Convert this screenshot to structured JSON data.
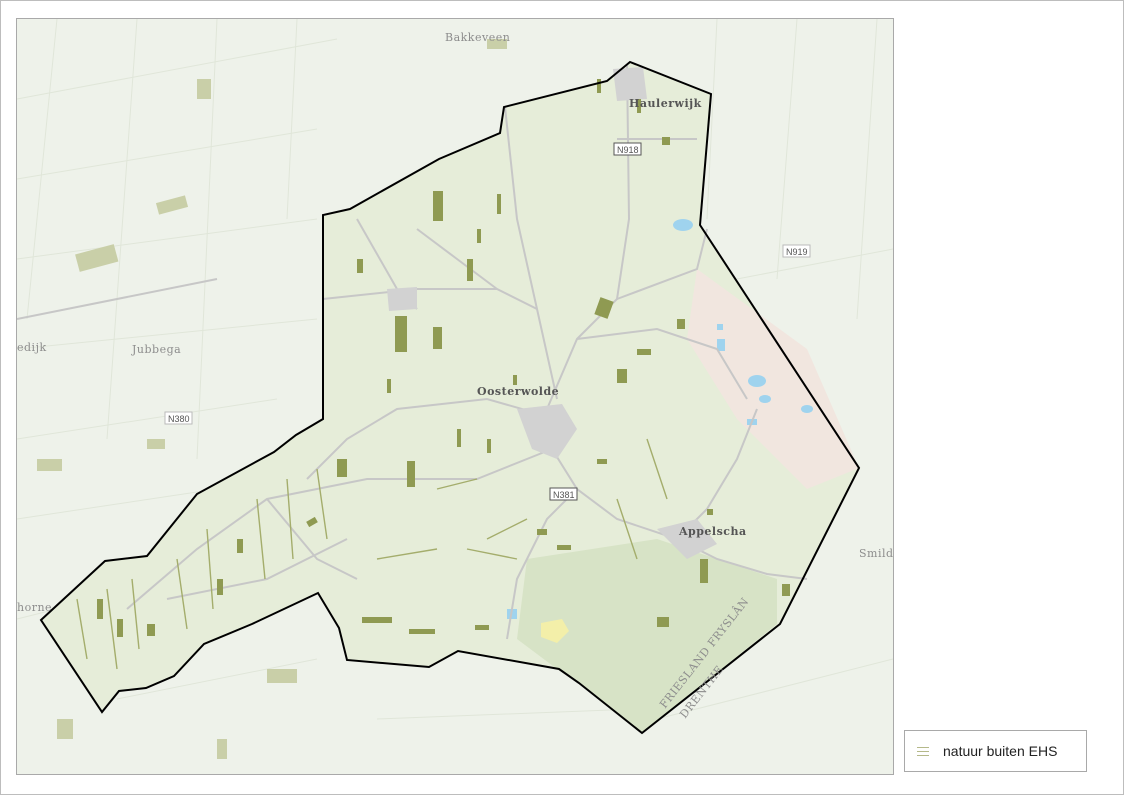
{
  "map": {
    "places": {
      "bakkeveen": "Bakkeveen",
      "haulerwijk": "Haulerwijk",
      "oosterwolde": "Oosterwolde",
      "appelscha": "Appelscha",
      "jubbega": "Jubbega",
      "edijk": "edijk",
      "horne": "horne",
      "smild": "Smild",
      "friesland": "FRIESLAND FRYSLÂN",
      "drenthe": "DRENTHE"
    },
    "roads": {
      "n918": "N918",
      "n919": "N919",
      "n380": "N380",
      "n381": "N381"
    },
    "colors": {
      "background": "#eef2ea",
      "municipality_fill": "#e6edd9",
      "nature_patch": "#8f9a52",
      "boundary": "#000000",
      "water": "#9fd3ee",
      "road": "#c7c7c7"
    }
  },
  "legend": {
    "label": "natuur buiten EHS",
    "icon": "hatched-swatch-icon"
  }
}
